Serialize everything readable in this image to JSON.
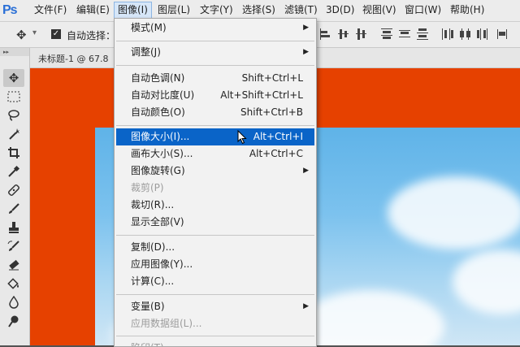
{
  "menubar": {
    "logo": "Ps",
    "items": [
      {
        "label": "文件(F)"
      },
      {
        "label": "编辑(E)"
      },
      {
        "label": "图像(I)"
      },
      {
        "label": "图层(L)"
      },
      {
        "label": "文字(Y)"
      },
      {
        "label": "选择(S)"
      },
      {
        "label": "滤镜(T)"
      },
      {
        "label": "3D(D)"
      },
      {
        "label": "视图(V)"
      },
      {
        "label": "窗口(W)"
      },
      {
        "label": "帮助(H)"
      }
    ],
    "active_index": 2
  },
  "options_bar": {
    "move_icon": "move-tool-icon",
    "auto_select_checked": true,
    "auto_select_label": "自动选择："
  },
  "document": {
    "tab_label": "未标题-1 @ 67.8"
  },
  "image_menu": {
    "items": [
      {
        "label": "模式(M)",
        "shortcut": "",
        "submenu": true
      },
      {
        "label": "调整(J)",
        "shortcut": "",
        "submenu": true
      },
      {
        "label": "自动色调(N)",
        "shortcut": "Shift+Ctrl+L",
        "submenu": false
      },
      {
        "label": "自动对比度(U)",
        "shortcut": "Alt+Shift+Ctrl+L",
        "submenu": false
      },
      {
        "label": "自动颜色(O)",
        "shortcut": "Shift+Ctrl+B",
        "submenu": false
      },
      {
        "label": "图像大小(I)...",
        "shortcut": "Alt+Ctrl+I",
        "submenu": false,
        "highlighted": true
      },
      {
        "label": "画布大小(S)...",
        "shortcut": "Alt+Ctrl+C",
        "submenu": false
      },
      {
        "label": "图像旋转(G)",
        "shortcut": "",
        "submenu": true
      },
      {
        "label": "裁剪(P)",
        "shortcut": "",
        "submenu": false,
        "disabled": true
      },
      {
        "label": "裁切(R)...",
        "shortcut": "",
        "submenu": false
      },
      {
        "label": "显示全部(V)",
        "shortcut": "",
        "submenu": false
      },
      {
        "label": "复制(D)...",
        "shortcut": "",
        "submenu": false
      },
      {
        "label": "应用图像(Y)...",
        "shortcut": "",
        "submenu": false
      },
      {
        "label": "计算(C)...",
        "shortcut": "",
        "submenu": false
      },
      {
        "label": "变量(B)",
        "shortcut": "",
        "submenu": true
      },
      {
        "label": "应用数据组(L)...",
        "shortcut": "",
        "submenu": false,
        "disabled": true
      },
      {
        "label": "陷印(T)...",
        "shortcut": "",
        "submenu": false,
        "disabled": true
      }
    ]
  },
  "colors": {
    "highlight": "#0a64c8",
    "artboard": "#e64100",
    "brand": "#2a6fd6"
  },
  "tools": [
    "move-tool-icon",
    "marquee-tool-icon",
    "lasso-tool-icon",
    "magic-wand-tool-icon",
    "crop-tool-icon",
    "eyedropper-tool-icon",
    "healing-brush-tool-icon",
    "brush-tool-icon",
    "clone-stamp-tool-icon",
    "history-brush-tool-icon",
    "eraser-tool-icon",
    "paint-bucket-tool-icon",
    "blur-tool-icon",
    "dodge-tool-icon"
  ]
}
